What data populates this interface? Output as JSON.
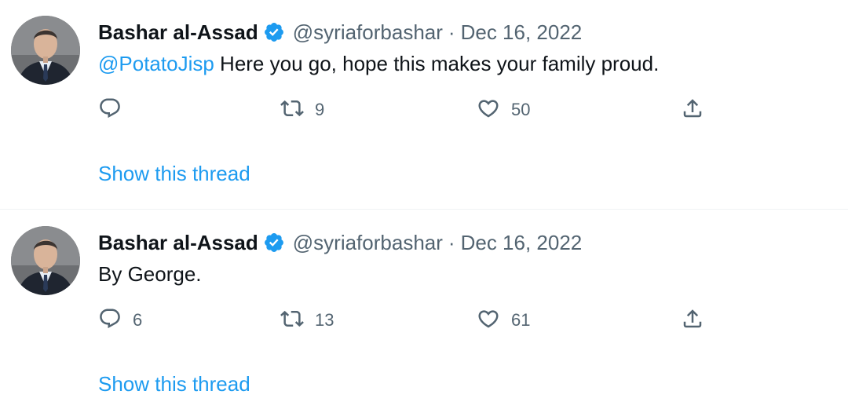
{
  "colors": {
    "accent": "#1d9bf0",
    "text_primary": "#0f1419",
    "text_secondary": "#536471",
    "divider": "#eff3f4"
  },
  "tweets": [
    {
      "author_name": "Bashar al-Assad",
      "verified": true,
      "handle": "@syriaforbashar",
      "separator": "·",
      "date": "Dec 16, 2022",
      "mention": "@PotatoJisp",
      "text": " Here you go, hope this makes your family proud.",
      "reply_count": "",
      "retweet_count": "9",
      "like_count": "50",
      "show_thread": "Show this thread"
    },
    {
      "author_name": "Bashar al-Assad",
      "verified": true,
      "handle": "@syriaforbashar",
      "separator": "·",
      "date": "Dec 16, 2022",
      "mention": "",
      "text": "By George.",
      "reply_count": "6",
      "retweet_count": "13",
      "like_count": "61",
      "show_thread": "Show this thread"
    }
  ],
  "icons": {
    "reply": "reply-icon",
    "retweet": "retweet-icon",
    "like": "heart-icon",
    "share": "share-icon",
    "verified": "verified-badge-icon"
  }
}
